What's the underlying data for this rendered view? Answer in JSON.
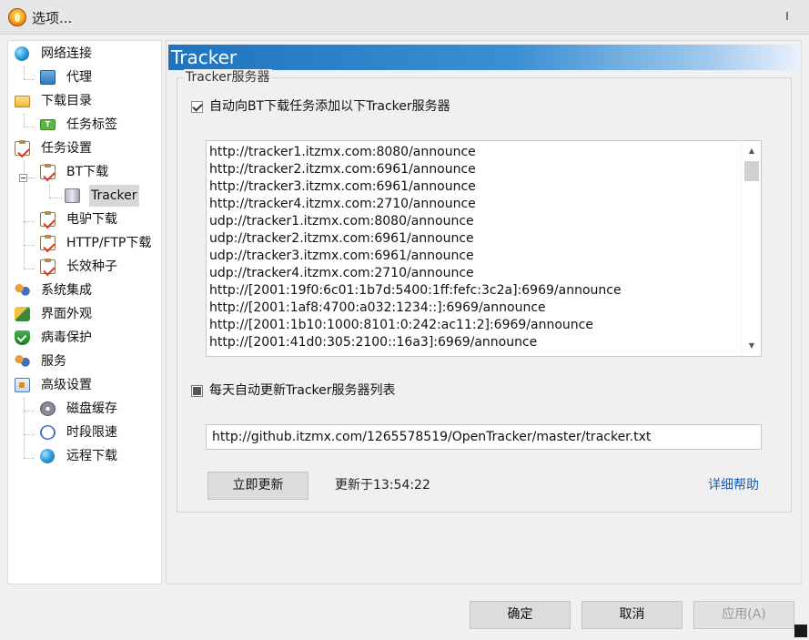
{
  "window": {
    "title": "选项..."
  },
  "nav": {
    "items": [
      {
        "label": "网络连接",
        "icon": "globe-icon"
      },
      {
        "label": "代理",
        "icon": "network-pc-icon"
      },
      {
        "label": "下载目录",
        "icon": "folder-icon"
      },
      {
        "label": "任务标签",
        "icon": "tag-icon",
        "icon_text": "T"
      },
      {
        "label": "任务设置",
        "icon": "clipboard-check-icon"
      },
      {
        "label": "BT下载",
        "icon": "clipboard-check-icon"
      },
      {
        "label": "Tracker",
        "icon": "server-icon",
        "selected": true
      },
      {
        "label": "电驴下载",
        "icon": "clipboard-check-icon"
      },
      {
        "label": "HTTP/FTP下载",
        "icon": "clipboard-check-icon"
      },
      {
        "label": "长效种子",
        "icon": "clipboard-check-icon"
      },
      {
        "label": "系统集成",
        "icon": "users-icon"
      },
      {
        "label": "界面外观",
        "icon": "appearance-icon"
      },
      {
        "label": "病毒保护",
        "icon": "shield-check-icon"
      },
      {
        "label": "服务",
        "icon": "users-icon"
      },
      {
        "label": "高级设置",
        "icon": "advanced-settings-icon"
      },
      {
        "label": "磁盘缓存",
        "icon": "disk-icon"
      },
      {
        "label": "时段限速",
        "icon": "clock-icon"
      },
      {
        "label": "远程下载",
        "icon": "globe-icon"
      }
    ]
  },
  "panel": {
    "title": "Tracker",
    "group_label": "Tracker服务器",
    "auto_add": {
      "label": "自动向BT下载任务添加以下Tracker服务器",
      "checked": true
    },
    "tracker_list": [
      "http://tracker1.itzmx.com:8080/announce",
      "http://tracker2.itzmx.com:6961/announce",
      "http://tracker3.itzmx.com:6961/announce",
      "http://tracker4.itzmx.com:2710/announce",
      "udp://tracker1.itzmx.com:8080/announce",
      "udp://tracker2.itzmx.com:6961/announce",
      "udp://tracker3.itzmx.com:6961/announce",
      "udp://tracker4.itzmx.com:2710/announce",
      "http://[2001:19f0:6c01:1b7d:5400:1ff:fefc:3c2a]:6969/announce",
      "http://[2001:1af8:4700:a032:1234::]:6969/announce",
      "http://[2001:1b10:1000:8101:0:242:ac11:2]:6969/announce",
      "http://[2001:41d0:305:2100::16a3]:6969/announce"
    ],
    "daily_update": {
      "label": "每天自动更新Tracker服务器列表",
      "state": "indeterminate"
    },
    "update_url": "http://github.itzmx.com/1265578519/OpenTracker/master/tracker.txt",
    "update_now_label": "立即更新",
    "updated_at": "更新于13:54:22",
    "help_label": "详细帮助"
  },
  "footer": {
    "ok_label": "确定",
    "cancel_label": "取消",
    "apply_label": "应用(A)",
    "apply_enabled": false
  },
  "colors": {
    "header_gradient_start": "#1f74bf",
    "link": "#1a5fb4"
  }
}
